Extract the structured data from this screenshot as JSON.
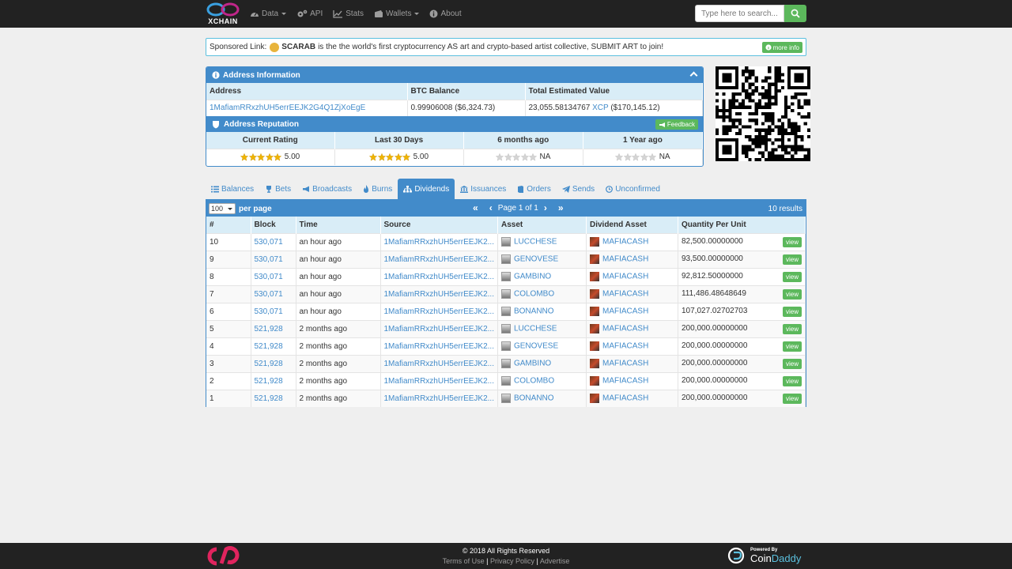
{
  "nav": {
    "logo_text": "XCHAIN",
    "items": [
      {
        "label": "Data",
        "icon": "dashboard-icon",
        "dropdown": true
      },
      {
        "label": "API",
        "icon": "cogs-icon",
        "dropdown": false
      },
      {
        "label": "Stats",
        "icon": "chart-icon",
        "dropdown": false
      },
      {
        "label": "Wallets",
        "icon": "wallet-icon",
        "dropdown": true
      },
      {
        "label": "About",
        "icon": "info-icon",
        "dropdown": false
      }
    ],
    "search_placeholder": "Type here to search..."
  },
  "sponsor": {
    "prefix": "Sponsored Link:",
    "name": "SCARAB",
    "text": "is the the world's first cryptocurrency AS art and crypto-based artist collective, SUBMIT ART to join!",
    "more_info": "more info"
  },
  "address_info": {
    "title": "Address Information",
    "headers": {
      "address": "Address",
      "btc_balance": "BTC Balance",
      "total": "Total Estimated Value"
    },
    "address": "1MafiamRRxzhUH5errEEJK2G4Q1ZjXoEgE",
    "btc_balance": "0.99906008 ($6,324.73)",
    "total_amount": "23,055.58134767",
    "total_unit": "XCP",
    "total_usd": "($170,145.12)"
  },
  "reputation": {
    "title": "Address Reputation",
    "feedback": "Feedback",
    "columns": [
      {
        "label": "Current Rating",
        "value": "5.00",
        "stars": 5
      },
      {
        "label": "Last 30 Days",
        "value": "5.00",
        "stars": 5
      },
      {
        "label": "6 months ago",
        "value": "NA",
        "stars": 0
      },
      {
        "label": "1 Year ago",
        "value": "NA",
        "stars": 0
      }
    ]
  },
  "tabs": [
    {
      "label": "Balances",
      "icon": "list-icon",
      "active": false
    },
    {
      "label": "Bets",
      "icon": "trophy-icon",
      "active": false
    },
    {
      "label": "Broadcasts",
      "icon": "bullhorn-icon",
      "active": false
    },
    {
      "label": "Burns",
      "icon": "fire-icon",
      "active": false
    },
    {
      "label": "Dividends",
      "icon": "sitemap-icon",
      "active": true
    },
    {
      "label": "Issuances",
      "icon": "bank-icon",
      "active": false
    },
    {
      "label": "Orders",
      "icon": "book-icon",
      "active": false
    },
    {
      "label": "Sends",
      "icon": "send-icon",
      "active": false
    },
    {
      "label": "Unconfirmed",
      "icon": "clock-icon",
      "active": false
    }
  ],
  "results": {
    "per_page_value": "100",
    "per_page_label": "per page",
    "page_label": "Page 1 of 1",
    "count": "10 results",
    "headers": [
      "#",
      "Block",
      "Time",
      "Source",
      "Asset",
      "Dividend Asset",
      "Quantity Per Unit"
    ],
    "view_label": "view",
    "rows": [
      {
        "n": "10",
        "block": "530,071",
        "time": "an hour ago",
        "source": "1MafiamRRxzhUH5errEEJK2...",
        "asset": "LUCCHESE",
        "div": "MAFIACASH",
        "qty": "82,500.00000000"
      },
      {
        "n": "9",
        "block": "530,071",
        "time": "an hour ago",
        "source": "1MafiamRRxzhUH5errEEJK2...",
        "asset": "GENOVESE",
        "div": "MAFIACASH",
        "qty": "93,500.00000000"
      },
      {
        "n": "8",
        "block": "530,071",
        "time": "an hour ago",
        "source": "1MafiamRRxzhUH5errEEJK2...",
        "asset": "GAMBINO",
        "div": "MAFIACASH",
        "qty": "92,812.50000000"
      },
      {
        "n": "7",
        "block": "530,071",
        "time": "an hour ago",
        "source": "1MafiamRRxzhUH5errEEJK2...",
        "asset": "COLOMBO",
        "div": "MAFIACASH",
        "qty": "111,486.48648649"
      },
      {
        "n": "6",
        "block": "530,071",
        "time": "an hour ago",
        "source": "1MafiamRRxzhUH5errEEJK2...",
        "asset": "BONANNO",
        "div": "MAFIACASH",
        "qty": "107,027.02702703"
      },
      {
        "n": "5",
        "block": "521,928",
        "time": "2 months ago",
        "source": "1MafiamRRxzhUH5errEEJK2...",
        "asset": "LUCCHESE",
        "div": "MAFIACASH",
        "qty": "200,000.00000000"
      },
      {
        "n": "4",
        "block": "521,928",
        "time": "2 months ago",
        "source": "1MafiamRRxzhUH5errEEJK2...",
        "asset": "GENOVESE",
        "div": "MAFIACASH",
        "qty": "200,000.00000000"
      },
      {
        "n": "3",
        "block": "521,928",
        "time": "2 months ago",
        "source": "1MafiamRRxzhUH5errEEJK2...",
        "asset": "GAMBINO",
        "div": "MAFIACASH",
        "qty": "200,000.00000000"
      },
      {
        "n": "2",
        "block": "521,928",
        "time": "2 months ago",
        "source": "1MafiamRRxzhUH5errEEJK2...",
        "asset": "COLOMBO",
        "div": "MAFIACASH",
        "qty": "200,000.00000000"
      },
      {
        "n": "1",
        "block": "521,928",
        "time": "2 months ago",
        "source": "1MafiamRRxzhUH5errEEJK2...",
        "asset": "BONANNO",
        "div": "MAFIACASH",
        "qty": "200,000.00000000"
      }
    ]
  },
  "footer": {
    "copyright": "© 2018 All Rights Reserved",
    "links": [
      "Terms of Use",
      "Privacy Policy",
      "Advertise"
    ],
    "powered_by": "Powered By",
    "brand_a": "Coin",
    "brand_b": "Daddy"
  },
  "colors": {
    "primary": "#428bca",
    "success": "#5cb85c",
    "nav_bg": "#222222",
    "header_cell": "#d9edf7"
  }
}
